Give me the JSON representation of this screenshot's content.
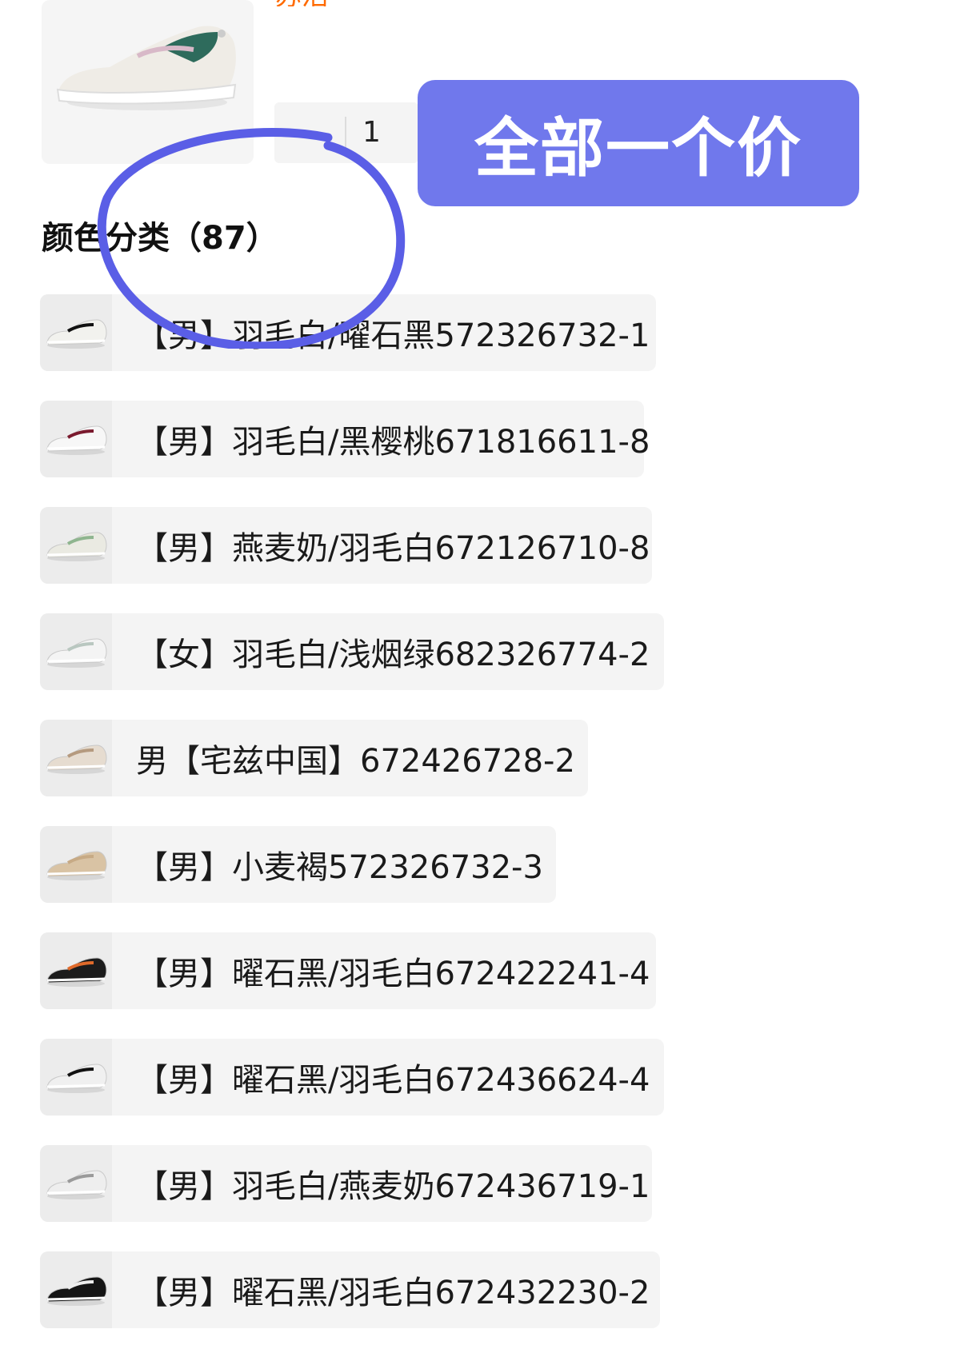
{
  "header": {
    "orange_price": "苏活",
    "quantity": "1",
    "banner": "全部一个价"
  },
  "section": {
    "title": "颜色分类（87）"
  },
  "variants": [
    {
      "label": "【男】羽毛白/曜石黑572326732-1",
      "shoe_color": "#f2f2ee",
      "accent": "#111111"
    },
    {
      "label": "【男】羽毛白/黑樱桃671816611-8",
      "shoe_color": "#f7f7f7",
      "accent": "#7a1a2e"
    },
    {
      "label": "【男】燕麦奶/羽毛白672126710-8",
      "shoe_color": "#eaeae2",
      "accent": "#8fb58f"
    },
    {
      "label": "【女】羽毛白/浅烟绿682326774-2",
      "shoe_color": "#f4f4f4",
      "accent": "#b9c7c0"
    },
    {
      "label": "男【宅兹中国】672426728-2",
      "shoe_color": "#e6dcd0",
      "accent": "#b59a7f"
    },
    {
      "label": "【男】小麦褐572326732-3",
      "shoe_color": "#d9c3a4",
      "accent": "#c7aa85"
    },
    {
      "label": "【男】曜石黑/羽毛白672422241-4",
      "shoe_color": "#1c1c1c",
      "accent": "#e06a2a"
    },
    {
      "label": "【男】曜石黑/羽毛白672436624-4",
      "shoe_color": "#f0f0f0",
      "accent": "#111111"
    },
    {
      "label": "【男】羽毛白/燕麦奶672436719-1",
      "shoe_color": "#eeeeee",
      "accent": "#9a9a9a"
    },
    {
      "label": "【男】曜石黑/羽毛白672432230-2",
      "shoe_color": "#151515",
      "accent": "#eeeeee"
    }
  ],
  "colors": {
    "banner_bg": "#7078ec",
    "annotation_stroke": "#5a5ee6",
    "orange": "#ff6a00",
    "item_bg": "#f4f4f4"
  }
}
